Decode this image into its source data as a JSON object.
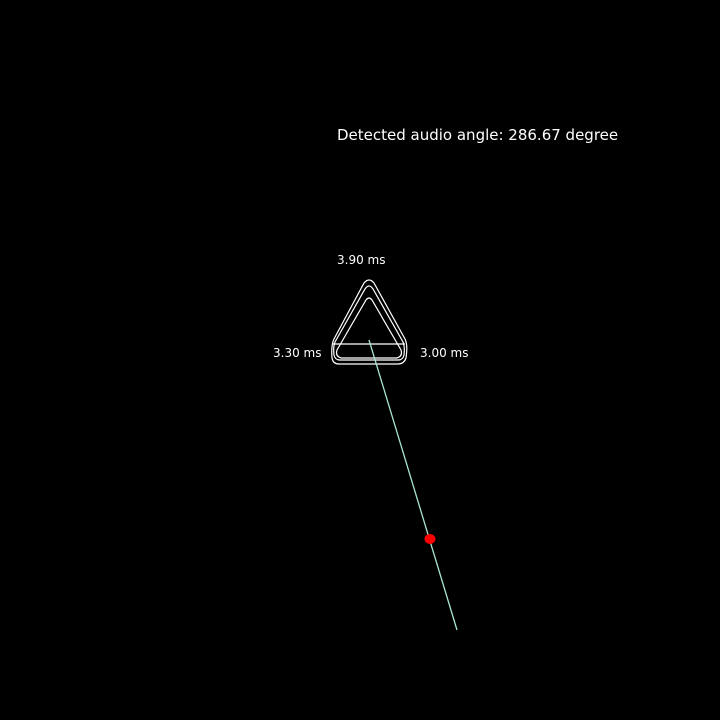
{
  "readout": {
    "angle_label": "Detected audio angle: 286.67 degree",
    "angle_degrees": 286.67
  },
  "mic_delays": {
    "top": "3.90 ms",
    "left": "3.30 ms",
    "right": "3.00 ms"
  },
  "colors": {
    "background": "#000000",
    "text": "#ffffff",
    "direction_line": "#a8e6cf",
    "source_marker": "#ff0000",
    "array_outline": "#ffffff"
  }
}
